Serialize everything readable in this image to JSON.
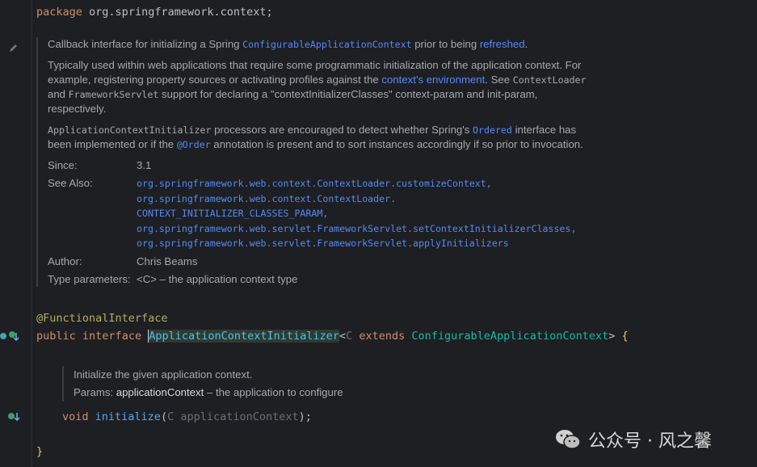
{
  "package_line": {
    "keyword": "package",
    "name": "org.springframework.context",
    "semi": ";"
  },
  "doc": {
    "p1": {
      "t1": "Callback interface for initializing a Spring ",
      "c1": "ConfigurableApplicationContext",
      "t2": " prior to being ",
      "l1": "refreshed",
      "t3": "."
    },
    "p2": {
      "t1": "Typically used within web applications that require some programmatic initialization of the application context. For example, registering property sources or activating profiles against the ",
      "l1": "context's environment",
      "t2": ". See ",
      "c1": "ContextLoader",
      "t3": " and ",
      "c2": "FrameworkServlet",
      "t4": " support for declaring a \"contextInitializerClasses\" context-param and init-param, respectively."
    },
    "p3": {
      "c1": "ApplicationContextInitializer",
      "t1": " processors are encouraged to detect whether Spring's ",
      "l1": "Ordered",
      "t2": " interface has been implemented or if the ",
      "l2": "@Order",
      "t3": " annotation is present and to sort instances accordingly if so prior to invocation."
    },
    "since_label": "Since:",
    "since_value": "3.1",
    "see_also_label": "See Also:",
    "see_also": [
      "org.springframework.web.context.ContextLoader.customizeContext,",
      "org.springframework.web.context.ContextLoader.",
      "CONTEXT_INITIALIZER_CLASSES_PARAM,",
      "org.springframework.web.servlet.FrameworkServlet.setContextInitializerClasses,",
      "org.springframework.web.servlet.FrameworkServlet.applyInitializers"
    ],
    "author_label": "Author:",
    "author_value": "Chris Beams",
    "type_params_label": "Type parameters:",
    "type_params_value": "<C> – the application context type"
  },
  "annotation_line": "@FunctionalInterface",
  "decl": {
    "public": "public",
    "interface": "interface",
    "name": "ApplicationContextInitializer",
    "lt": "<",
    "tparam": "C",
    "extends": "extends",
    "bound": "ConfigurableApplicationContext",
    "gt": ">",
    "brace": "{"
  },
  "method_doc": {
    "line1": "Initialize the given application context.",
    "params_label": "Params: ",
    "param_name": "applicationContext",
    "param_desc": " – the application to configure"
  },
  "method": {
    "ret": "void",
    "name": "initialize",
    "open": "(",
    "ptype": "C",
    "pname": "applicationContext",
    "close": ");"
  },
  "closing_brace": "}",
  "watermark": {
    "text": "公众号 · 风之馨"
  },
  "colors": {
    "background": "#1e1f22",
    "keyword": "#cf8e6d",
    "annotation": "#b3ae60",
    "link": "#548af7",
    "function": "#56a8f5"
  }
}
